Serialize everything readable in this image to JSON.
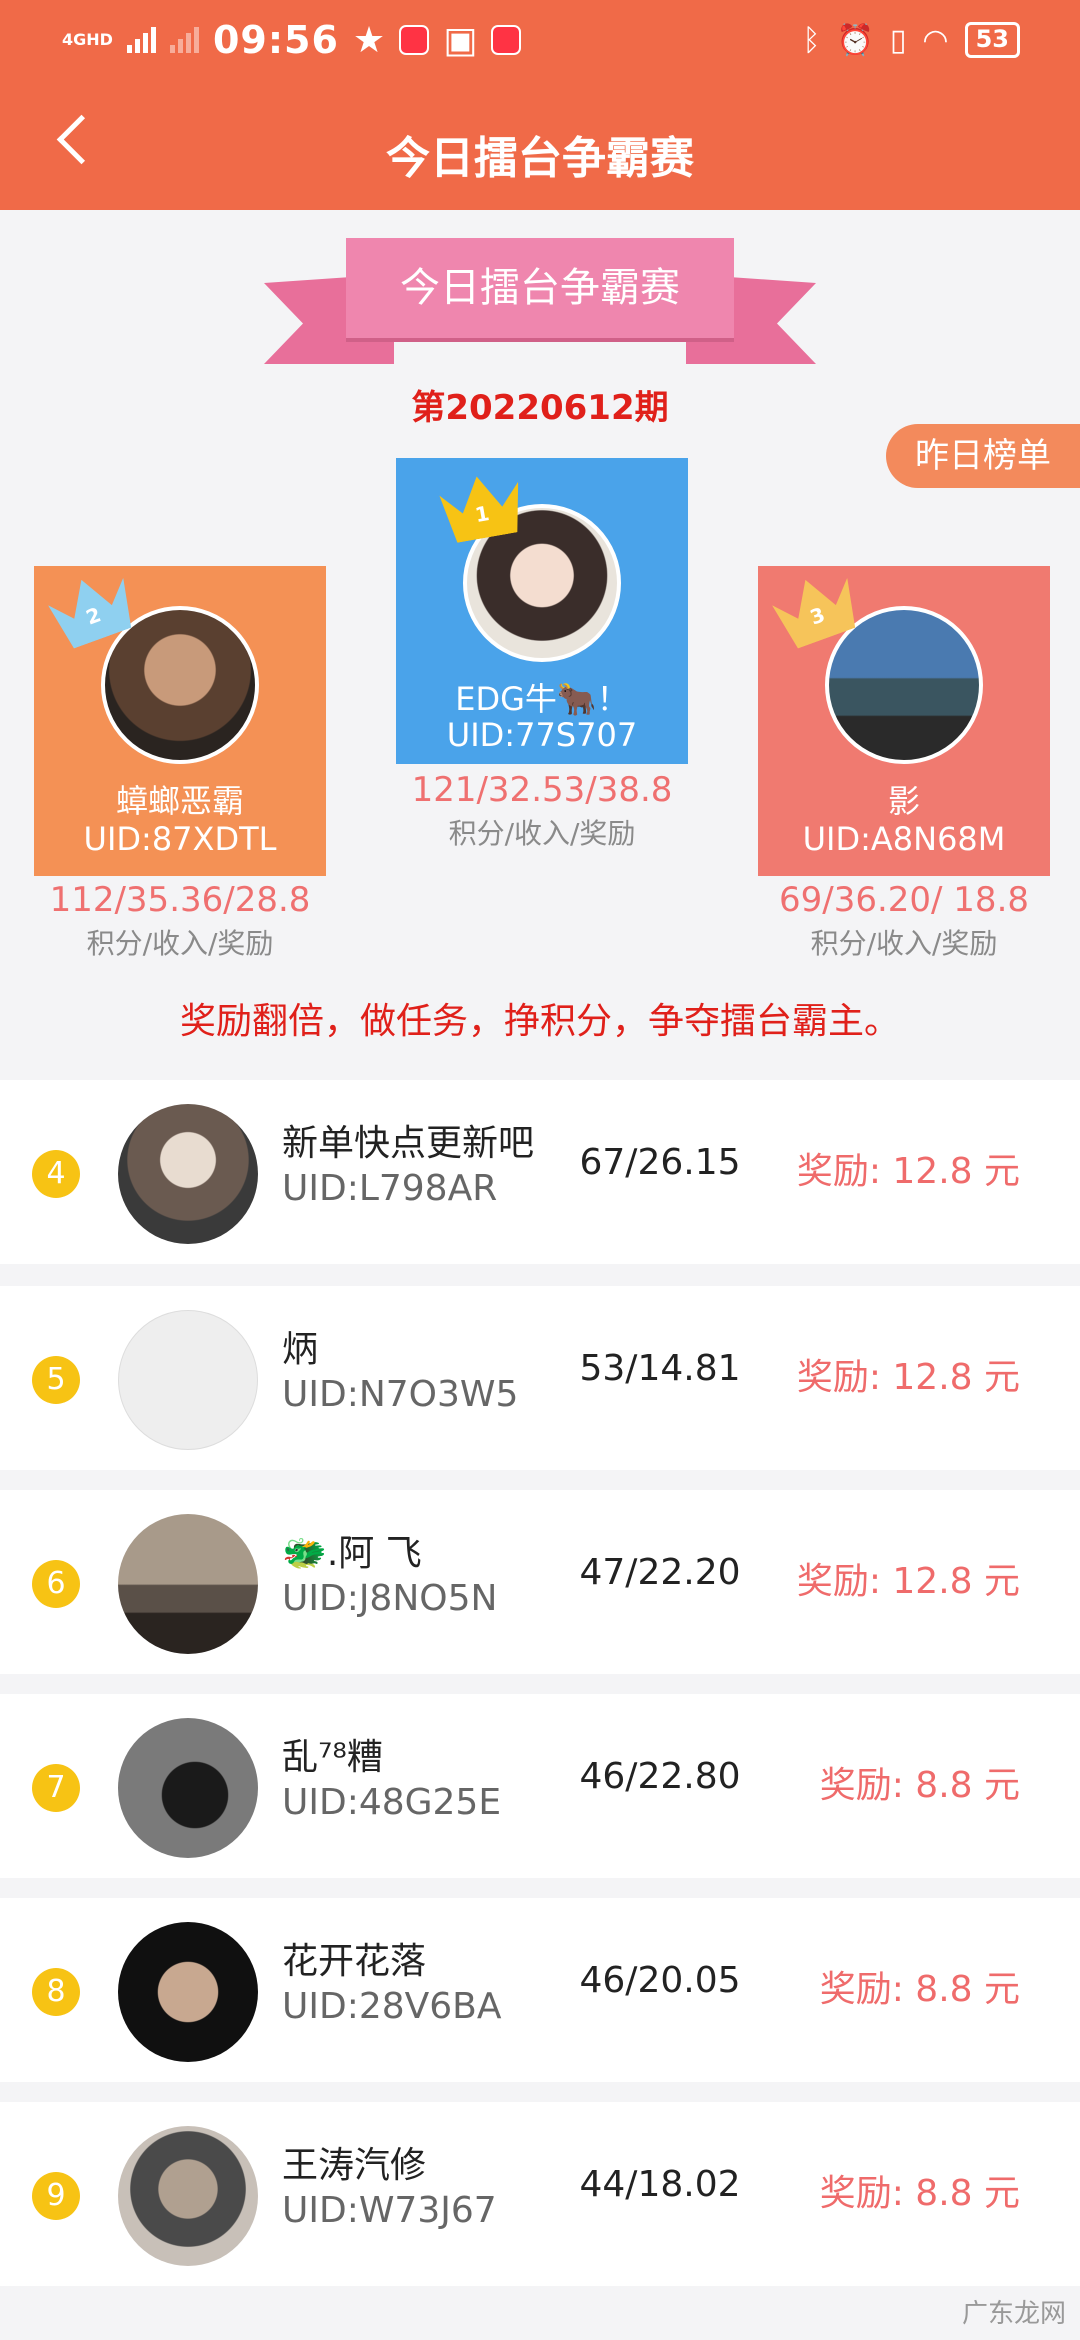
{
  "status_bar": {
    "network": "4GHD",
    "time": "09:56",
    "battery": "53"
  },
  "header": {
    "title": "今日擂台争霸赛"
  },
  "banner": {
    "title": "今日擂台争霸赛",
    "period": "第20220612期",
    "yesterday_label": "昨日榜单"
  },
  "podium": [
    {
      "rank": "1",
      "name": "EDG牛🐂！",
      "uid": "UID:77S707",
      "stats": "121/32.53/38.8",
      "stats_label": "积分/收入/奖励"
    },
    {
      "rank": "2",
      "name": "蟑螂恶霸",
      "uid": "UID:87XDTL",
      "stats": "112/35.36/28.8",
      "stats_label": "积分/收入/奖励"
    },
    {
      "rank": "3",
      "name": "影",
      "uid": "UID:A8N68M",
      "stats": "69/36.20/ 18.8",
      "stats_label": "积分/收入/奖励"
    }
  ],
  "slogan": "奖励翻倍，做任务，挣积分，争夺擂台霸主。",
  "list": [
    {
      "rank": "4",
      "name": "新单快点更新吧",
      "uid": "UID:L798AR",
      "score": "67/26.15",
      "reward": "奖励: 12.8 元"
    },
    {
      "rank": "5",
      "name": "炳",
      "uid": "UID:N7O3W5",
      "score": "53/14.81",
      "reward": "奖励: 12.8 元"
    },
    {
      "rank": "6",
      "name": "🐲.阿 飞",
      "uid": "UID:J8NO5N",
      "score": "47/22.20",
      "reward": "奖励: 12.8 元"
    },
    {
      "rank": "7",
      "name": "乱⁷⁸糟",
      "uid": "UID:48G25E",
      "score": "46/22.80",
      "reward": "奖励: 8.8 元"
    },
    {
      "rank": "8",
      "name": "花开花落",
      "uid": "UID:28V6BA",
      "score": "46/20.05",
      "reward": "奖励: 8.8 元"
    },
    {
      "rank": "9",
      "name": "王涛汽修",
      "uid": "UID:W73J67",
      "score": "44/18.02",
      "reward": "奖励: 8.8 元"
    }
  ],
  "watermark": "广东龙网"
}
